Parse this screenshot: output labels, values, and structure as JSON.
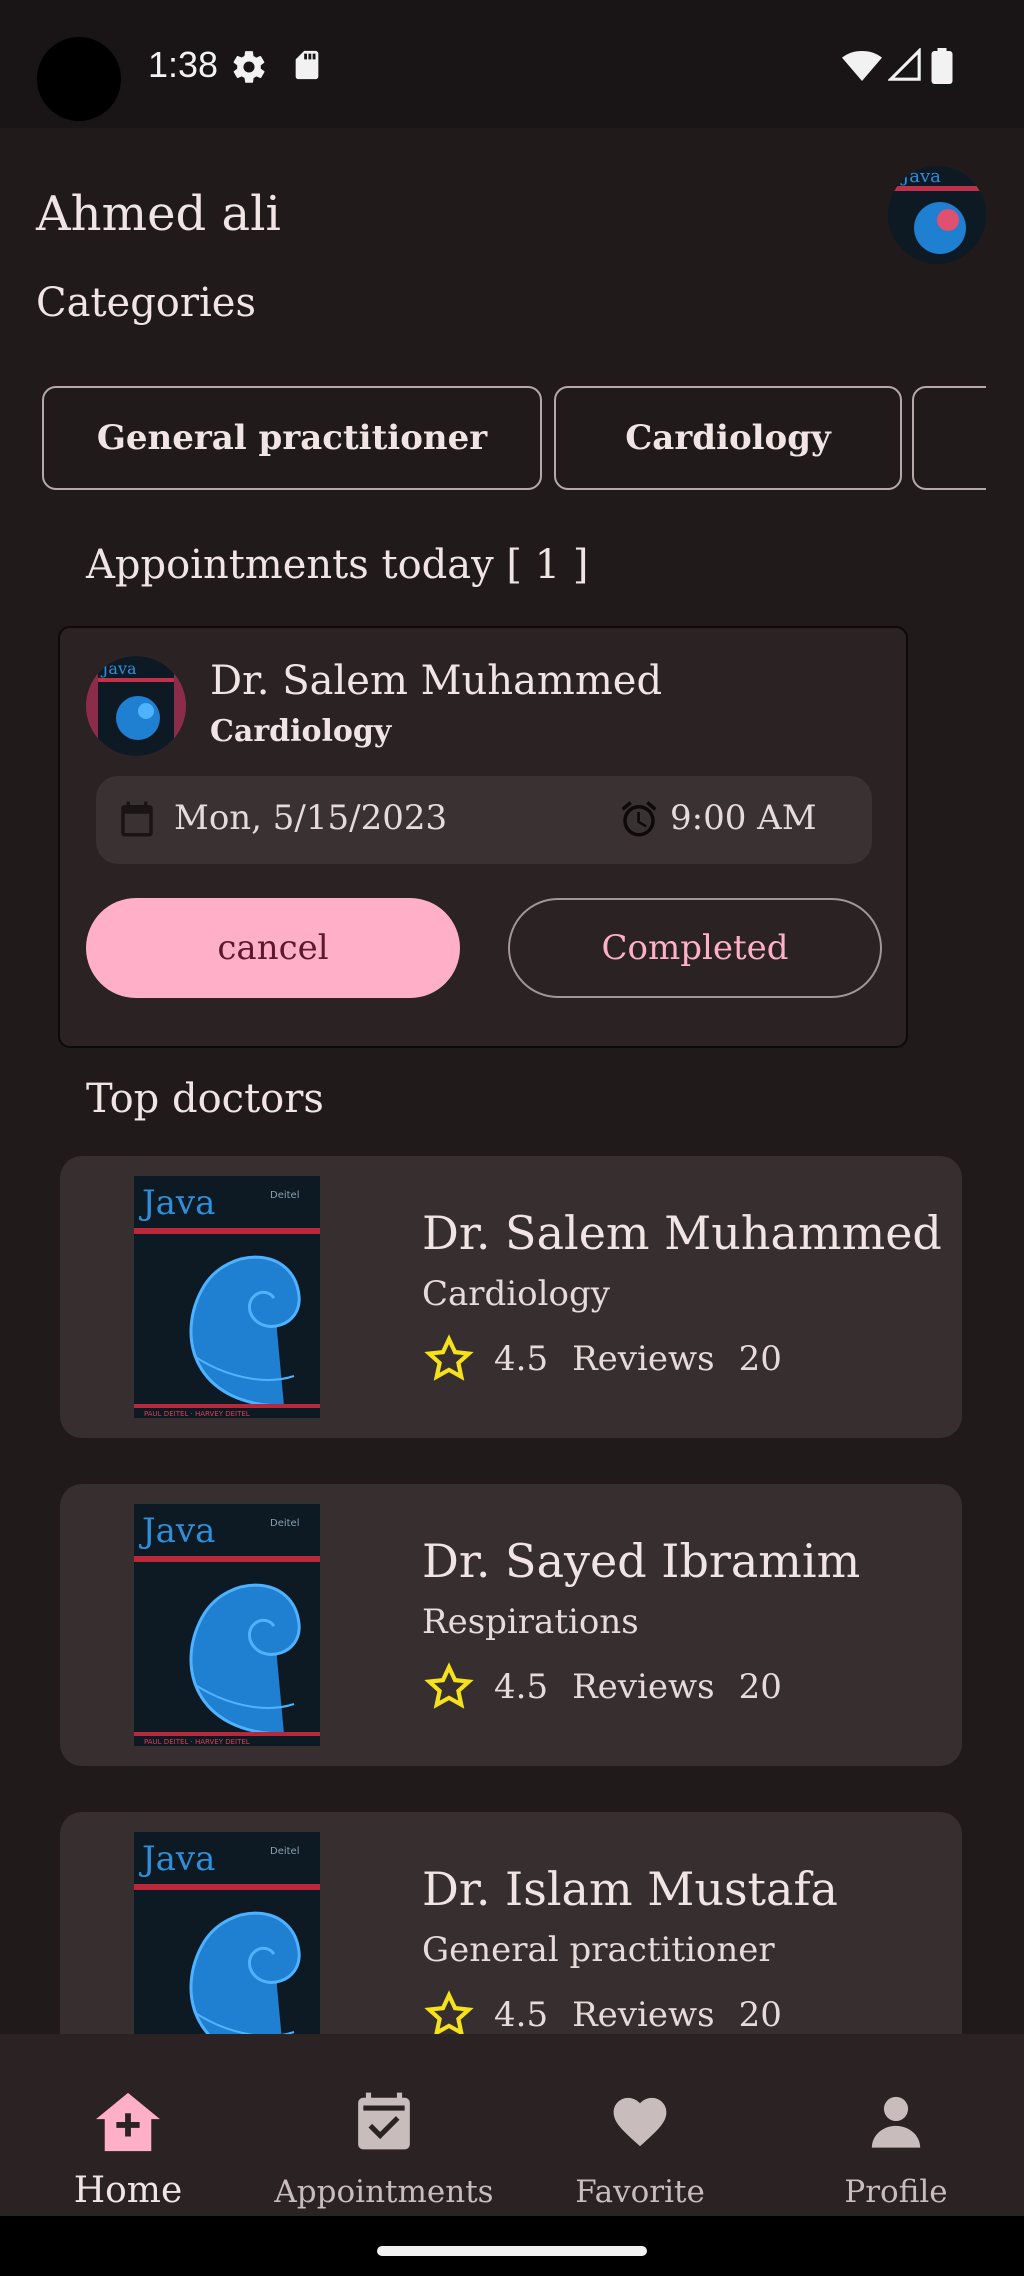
{
  "status_bar": {
    "time": "1:38",
    "icons": [
      "settings-icon",
      "sd-card-icon",
      "wifi-icon",
      "signal-icon",
      "battery-icon"
    ]
  },
  "header": {
    "user_name": "Ahmed ali",
    "avatar_icon": "profile-image"
  },
  "categories": {
    "title": "Categories",
    "items": [
      {
        "label": "General practitioner"
      },
      {
        "label": "Cardiology"
      },
      {
        "label": ""
      }
    ]
  },
  "appointments": {
    "title": "Appointments today [ 1 ]",
    "card": {
      "doctor": "Dr. Salem Muhammed",
      "specialty": "Cardiology",
      "date": "Mon, 5/15/2023",
      "time": "9:00 AM",
      "cancel_label": "cancel",
      "completed_label": "Completed"
    }
  },
  "top_doctors": {
    "title": "Top doctors",
    "items": [
      {
        "name": "Dr. Salem Muhammed",
        "specialty": "Cardiology",
        "rating": "4.5",
        "reviews_label": "Reviews",
        "reviews": "20"
      },
      {
        "name": "Dr. Sayed Ibramim",
        "specialty": "Respirations",
        "rating": "4.5",
        "reviews_label": "Reviews",
        "reviews": "20"
      },
      {
        "name": "Dr. Islam Mustafa",
        "specialty": "General practitioner",
        "rating": "4.5",
        "reviews_label": "Reviews",
        "reviews": "20"
      }
    ]
  },
  "bottom_nav": {
    "items": [
      {
        "label": "Home",
        "icon": "home-medical-icon",
        "active": true
      },
      {
        "label": "Appointments",
        "icon": "calendar-check-icon",
        "active": false
      },
      {
        "label": "Favorite",
        "icon": "heart-icon",
        "active": false
      },
      {
        "label": "Profile",
        "icon": "person-icon",
        "active": false
      }
    ]
  },
  "colors": {
    "background": "#201a1b",
    "accent_pink": "#ffb0c8",
    "card": "#372e2f",
    "star": "#f5e21b"
  }
}
